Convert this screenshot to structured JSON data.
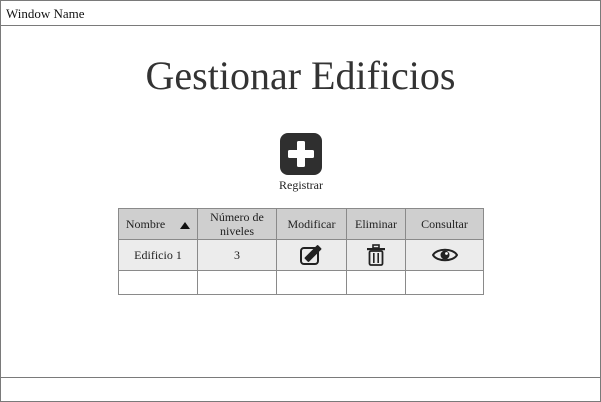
{
  "window": {
    "title": "Window Name"
  },
  "page": {
    "title": "Gestionar Edificios"
  },
  "actions": {
    "register_label": "Registrar"
  },
  "table": {
    "columns": {
      "name": "Nombre",
      "levels": "Número de niveles",
      "modify": "Modificar",
      "delete": "Eliminar",
      "view": "Consultar"
    },
    "sort": {
      "column": "Nombre",
      "direction": "ascending"
    },
    "rows": [
      {
        "name": "Edificio 1",
        "levels": "3",
        "icons": [
          "edit-icon",
          "trash-icon",
          "eye-icon"
        ]
      }
    ]
  },
  "colors": {
    "button_bg": "#2f2f2f",
    "header_bg": "#cfcfcf",
    "row_bg": "#ececec"
  }
}
